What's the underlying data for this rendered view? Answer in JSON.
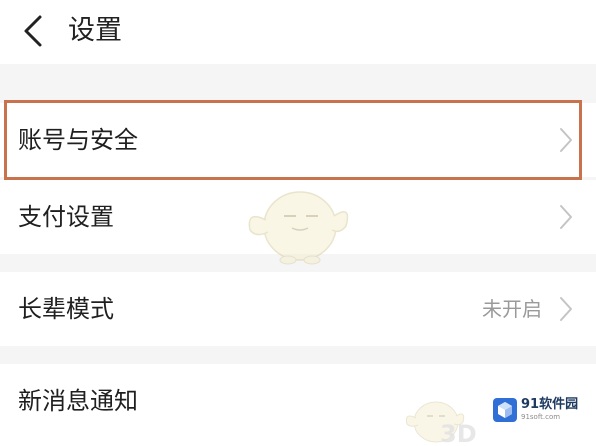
{
  "header": {
    "title": "设置",
    "back_icon": "chevron-left-icon"
  },
  "settings": {
    "account_security": {
      "label": "账号与安全"
    },
    "payment": {
      "label": "支付设置"
    },
    "elder_mode": {
      "label": "长辈模式",
      "value": "未开启"
    },
    "notifications": {
      "label": "新消息通知"
    }
  },
  "annotation": {
    "highlight_color": "#c9734e"
  },
  "watermark": {
    "site_name": "91软件园",
    "site_url": "91soft.com",
    "mark_text": "3D"
  }
}
